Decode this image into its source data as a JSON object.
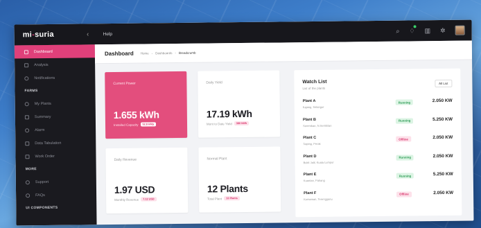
{
  "brand": {
    "logo_main": "mi",
    "logo_dash": "-",
    "logo_rest": "suria",
    "collapse_icon": "chevron-left-icon"
  },
  "topbar": {
    "help": "Help",
    "icons": [
      "search-icon",
      "bell-icon",
      "chart-icon",
      "gear-icon",
      "avatar"
    ]
  },
  "sidebar": {
    "items_top": [
      {
        "label": "Dashboard",
        "icon": "grid-icon",
        "active": true
      },
      {
        "label": "Analysis",
        "icon": "chart-icon"
      },
      {
        "label": "Notifications",
        "icon": "bell-icon"
      }
    ],
    "section_farms": "FARMS",
    "items_farms": [
      {
        "label": "My Plants",
        "icon": "plant-icon"
      },
      {
        "label": "Summary",
        "icon": "list-icon"
      },
      {
        "label": "Alarm",
        "icon": "alarm-icon"
      },
      {
        "label": "Data Tabulation",
        "icon": "table-icon"
      },
      {
        "label": "Work Order",
        "icon": "clipboard-icon"
      }
    ],
    "section_more": "MORE",
    "items_more": [
      {
        "label": "Support",
        "icon": "support-icon"
      },
      {
        "label": "FAQs",
        "icon": "question-icon"
      }
    ],
    "section_ui": "UI COMPONENTS"
  },
  "header": {
    "title": "Dashboard",
    "breadcrumb": [
      "Home",
      "-",
      "Dashboards",
      "-",
      "Breadcrumb"
    ]
  },
  "cards": {
    "current_power": {
      "title": "Current Power",
      "value": "1.655 kWh",
      "sub": "Installed Capacity",
      "pill": "52.8 kWp"
    },
    "daily_yield": {
      "title": "Daily Yield",
      "value": "17.19 kWh",
      "sub": "Mont to Date Yield",
      "pill": "380 kWh"
    },
    "daily_revenue": {
      "title": "Daily Revenue",
      "value": "1.97 USD",
      "sub": "Monthly Revenue",
      "pill": "7.12 USD"
    },
    "normal_plant": {
      "title": "Normal Plant",
      "value": "12 Plants",
      "sub": "Total Plant",
      "pill": "13 Plants"
    }
  },
  "watch_list": {
    "title": "Watch List",
    "subtitle": "List of the plants",
    "all_button": "All List",
    "rows": [
      {
        "name": "Plant A",
        "location": "Kajang, Selangor",
        "status": "Running",
        "kw": "2.050 KW"
      },
      {
        "name": "Plant B",
        "location": "Seremban, N.Sembilan",
        "status": "Running",
        "kw": "5.250 KW"
      },
      {
        "name": "Plant C",
        "location": "Taiping, Perak",
        "status": "Offline",
        "kw": "2.050 KW"
      },
      {
        "name": "Plant D",
        "location": "Bukit Jalil, Kuala Lumpur",
        "status": "Running",
        "kw": "2.050 KW"
      },
      {
        "name": "Plant E",
        "location": "Kuantan, Pahang",
        "status": "Running",
        "kw": "5.250 KW"
      },
      {
        "name": "Plant F",
        "location": "Kemaman, Terengganu",
        "status": "Offline",
        "kw": "2.050 KW"
      }
    ]
  },
  "colors": {
    "accent": "#e0407a",
    "sidebar": "#1a1a1f",
    "running": "#2d9b54",
    "offline": "#d8356c"
  }
}
